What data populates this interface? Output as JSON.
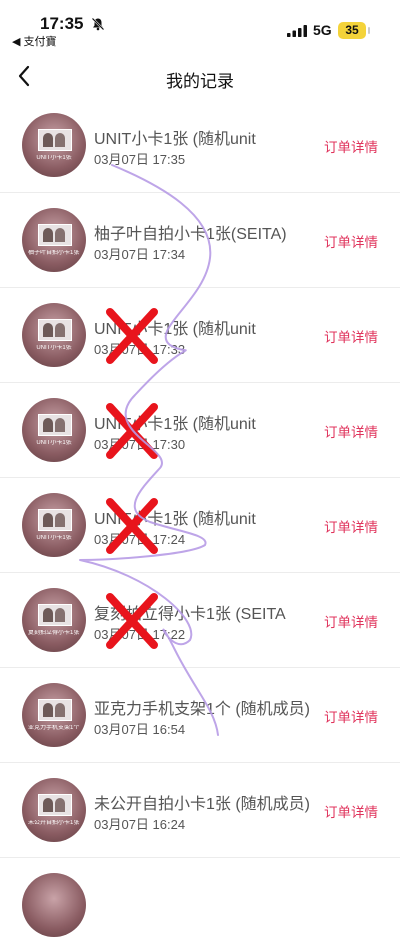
{
  "status_bar": {
    "time": "17:35",
    "back_app": "◀ 支付寶",
    "network": "5G",
    "battery": "35"
  },
  "header": {
    "title": "我的记录"
  },
  "detail_label": "订单详情",
  "orders": [
    {
      "name": "UNIT小卡1张 (随机unit",
      "date": "03月07日 17:35",
      "thumb_caption": "UNIT小卡1张",
      "crossed": false
    },
    {
      "name": "柚子叶自拍小卡1张(SEITA)",
      "date": "03月07日 17:34",
      "thumb_caption": "柚子叶自拍小卡1张 (SEITA)",
      "crossed": false
    },
    {
      "name": "UNIT小卡1张 (随机unit",
      "date": "03月07日 17:33",
      "thumb_caption": "UNIT小卡1张",
      "crossed": true
    },
    {
      "name": "UNIT小卡1张 (随机unit",
      "date": "03月07日 17:30",
      "thumb_caption": "UNIT小卡1张",
      "crossed": true
    },
    {
      "name": "UNIT小卡1张 (随机unit",
      "date": "03月07日 17:24",
      "thumb_caption": "UNIT小卡1张",
      "crossed": true
    },
    {
      "name": "复刻拍立得小卡1张 (SEITA",
      "date": "03月07日 17:22",
      "thumb_caption": "复刻拍立得小卡1张 (SEITA)",
      "crossed": true
    },
    {
      "name": "亚克力手机支架1个 (随机成员)",
      "date": "03月07日 16:54",
      "thumb_caption": "亚克力手机支架1个 (随机成员)",
      "crossed": false
    },
    {
      "name": "未公开自拍小卡1张 (随机成员)",
      "date": "03月07日 16:24",
      "thumb_caption": "未公开自拍小卡1张 (随机成员)",
      "crossed": false
    }
  ],
  "colors": {
    "accent": "#e0325b",
    "annotation_cross": "#e8141c",
    "annotation_scribble": "#b79be6"
  }
}
